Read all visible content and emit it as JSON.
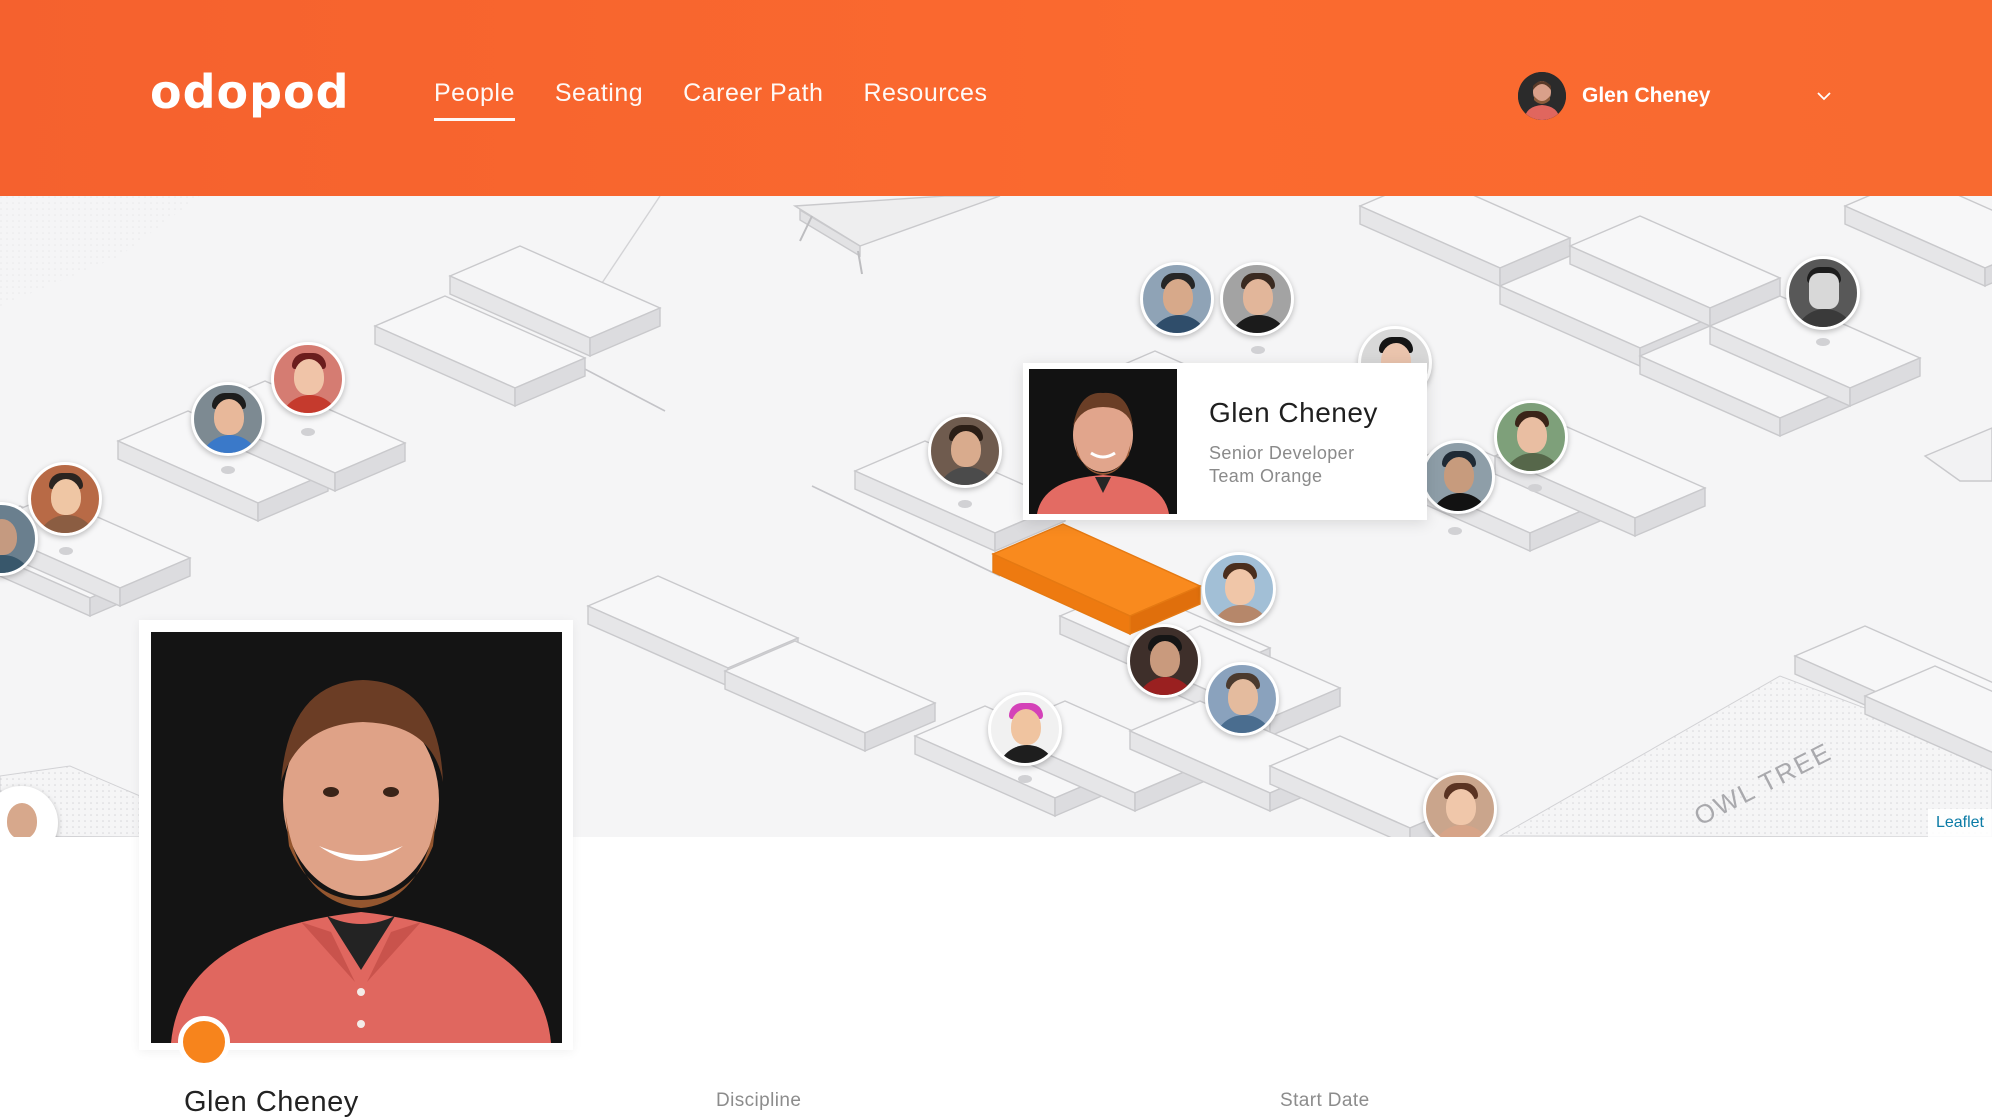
{
  "app": {
    "logo": "odopod"
  },
  "nav": {
    "items": [
      {
        "label": "People",
        "active": true
      },
      {
        "label": "Seating",
        "active": false
      },
      {
        "label": "Career Path",
        "active": false
      },
      {
        "label": "Resources",
        "active": false
      }
    ]
  },
  "user": {
    "name": "Glen Cheney"
  },
  "map": {
    "attribution": "Leaflet",
    "area_label": "OWL TREE",
    "selected_desk_color": "#f7841c",
    "card": {
      "name": "Glen Cheney",
      "title": "Senior Developer",
      "team": "Team Orange"
    }
  },
  "profile": {
    "name": "Glen Cheney",
    "status_color": "#f7841c",
    "fields": [
      {
        "label": "Discipline"
      },
      {
        "label": "Start Date"
      }
    ]
  },
  "colors": {
    "brand": "#f8642f",
    "accent": "#f7841c",
    "link": "#0b7ba6"
  }
}
